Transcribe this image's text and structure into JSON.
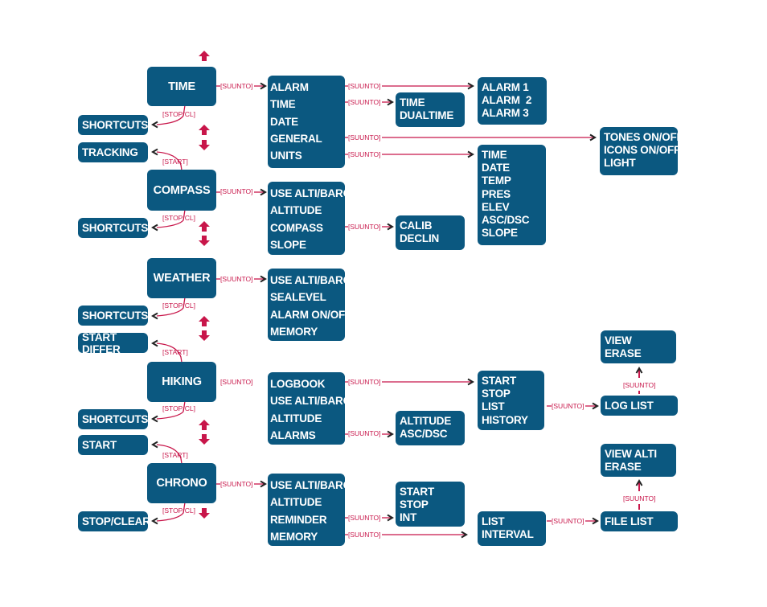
{
  "colors": {
    "box": "#0b5880",
    "connector": "#c8164a",
    "arrowhead": "#222222"
  },
  "button_labels": {
    "suunto": "[SUUNTO]",
    "stop_cl": "[STOP/CL]",
    "start": "[START]"
  },
  "modes": [
    {
      "id": "time",
      "label": "TIME"
    },
    {
      "id": "compass",
      "label": "COMPASS"
    },
    {
      "id": "weather",
      "label": "WEATHER"
    },
    {
      "id": "hiking",
      "label": "HIKING"
    },
    {
      "id": "chrono",
      "label": "CHRONO"
    }
  ],
  "side_boxes": [
    {
      "id": "time-shortcuts",
      "label": "SHORTCUTS",
      "from": "time",
      "button": "[STOP/CL]"
    },
    {
      "id": "time-tracking",
      "label": "TRACKING",
      "from": "compass",
      "button": "[START]"
    },
    {
      "id": "compass-shortcuts",
      "label": "SHORTCUTS",
      "from": "compass",
      "button": "[STOP/CL]"
    },
    {
      "id": "weather-shortcuts",
      "label": "SHORTCUTS",
      "from": "weather",
      "button": "[STOP/CL]"
    },
    {
      "id": "start-differ",
      "label": "START DIFFER",
      "from": "hiking",
      "button": "[START]"
    },
    {
      "id": "hiking-shortcuts",
      "label": "SHORTCUTS",
      "from": "hiking",
      "button": "[STOP/CL]"
    },
    {
      "id": "hiking-start",
      "label": "START",
      "from": "chrono",
      "button": "[START]"
    },
    {
      "id": "stop-clear",
      "label": "STOP/CLEAR",
      "from": "chrono",
      "button": "[STOP/CL]"
    }
  ],
  "menus": [
    {
      "id": "time-menu",
      "items": [
        "ALARM",
        "TIME",
        "DATE",
        "GENERAL",
        "UNITS"
      ]
    },
    {
      "id": "compass-menu",
      "items": [
        "USE ALTI/BARO",
        "ALTITUDE",
        "COMPASS",
        "SLOPE"
      ]
    },
    {
      "id": "weather-menu",
      "items": [
        "USE ALTI/BARO",
        "SEALEVEL",
        "ALARM ON/OFF",
        "MEMORY"
      ]
    },
    {
      "id": "hiking-menu",
      "items": [
        "LOGBOOK",
        "USE ALTI/BARO",
        "ALTITUDE",
        "ALARMS"
      ]
    },
    {
      "id": "chrono-menu",
      "items": [
        "USE ALTI/BARO",
        "ALTITUDE",
        "REMINDER",
        "MEMORY"
      ]
    }
  ],
  "submenus": [
    {
      "id": "alarms-sub",
      "items": [
        "ALARM 1",
        "ALARM  2",
        "ALARM 3"
      ]
    },
    {
      "id": "time-sub",
      "items": [
        "TIME",
        "DUALTIME"
      ]
    },
    {
      "id": "general-sub",
      "items": [
        "TONES ON/OFF",
        "ICONS ON/OFF",
        "LIGHT"
      ]
    },
    {
      "id": "units-sub",
      "items": [
        "TIME",
        "DATE",
        "TEMP",
        "PRES",
        "ELEV",
        "ASC/DSC",
        "SLOPE"
      ]
    },
    {
      "id": "compass-sub",
      "items": [
        "CALIB",
        "DECLIN"
      ]
    },
    {
      "id": "logbook-sub",
      "items": [
        "START",
        "STOP",
        "LIST",
        "HISTORY"
      ]
    },
    {
      "id": "log-list",
      "items": [
        "LOG LIST"
      ]
    },
    {
      "id": "log-view",
      "items": [
        "VIEW",
        "ERASE"
      ]
    },
    {
      "id": "hiking-alarms-sub",
      "items": [
        "ALTITUDE",
        "ASC/DSC"
      ]
    },
    {
      "id": "reminder-sub",
      "items": [
        "START",
        "STOP",
        "INT"
      ]
    },
    {
      "id": "memory-sub",
      "items": [
        "LIST",
        "INTERVAL"
      ]
    },
    {
      "id": "file-list",
      "items": [
        "FILE LIST"
      ]
    },
    {
      "id": "file-view",
      "items": [
        "VIEW ALTI",
        "ERASE"
      ]
    }
  ]
}
